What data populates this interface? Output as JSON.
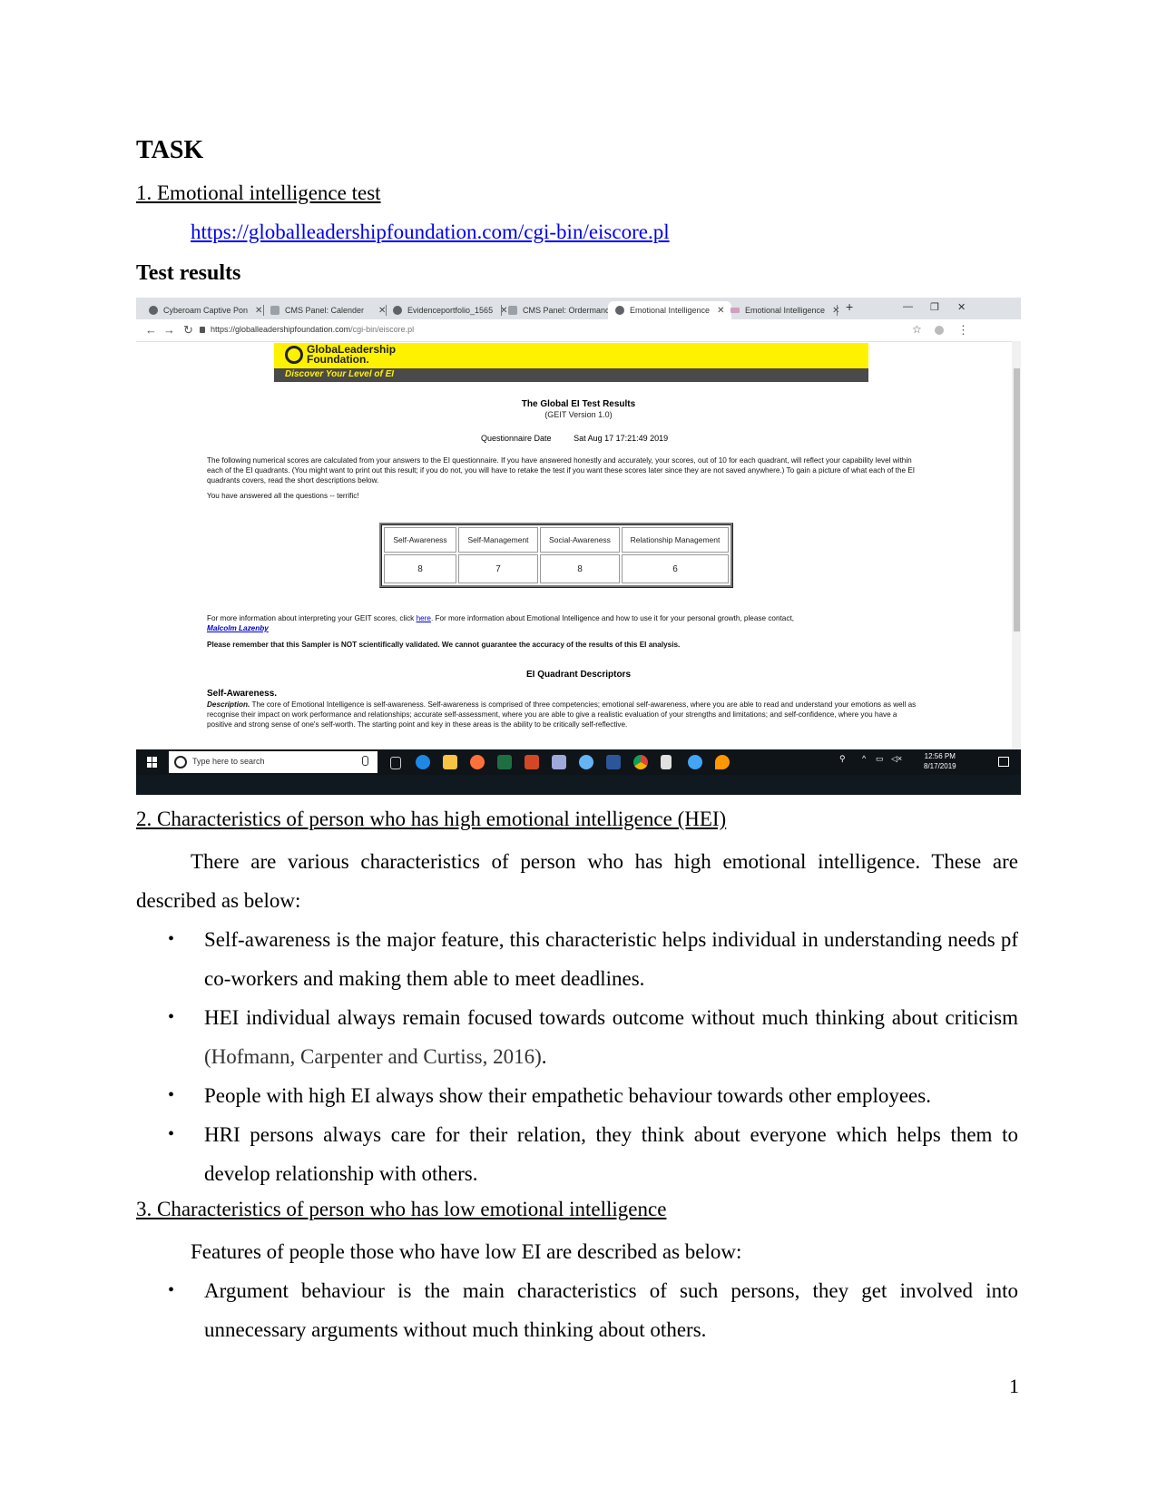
{
  "document": {
    "task_heading": "TASK",
    "section1_heading": "1. Emotional intelligence test",
    "test_link": "https://globalleadershipfoundation.com/cgi-bin/eiscore.pl",
    "test_results_heading": "Test results",
    "section2_heading": "2. Characteristics of person who has high emotional intelligence (HEI)",
    "section2_intro": "There are various characteristics of person who has high emotional intelligence. These are described as below:",
    "section2_bullets": [
      {
        "text": "Self-awareness is the major feature, this characteristic helps individual in understanding needs pf co-workers and making them able to meet deadlines.",
        "citation": ""
      },
      {
        "text": "HEI individual always remain focused towards outcome without much thinking about criticism ",
        "citation": "(Hofmann, Carpenter and Curtiss, 2016)",
        "after": "."
      },
      {
        "text": "People with high EI always show their empathetic behaviour towards other employees.",
        "citation": ""
      },
      {
        "text": "HRI persons always care for their relation, they think about everyone which helps them to develop relationship with others.",
        "citation": ""
      }
    ],
    "section3_heading": "3. Characteristics of person who has low emotional intelligence",
    "section3_intro": "Features of people those who have low EI are described as below:",
    "section3_bullets": [
      {
        "text": "Argument behaviour is the main characteristics of such persons, they get involved into unnecessary arguments without much thinking about others."
      }
    ],
    "bullet_glyph": "•",
    "page_number": "1"
  },
  "screenshot": {
    "tabs": [
      {
        "label": "Cyberoam Captive Pon",
        "icon": "globe-icon",
        "active": false
      },
      {
        "label": "CMS Panel: Calender",
        "icon": "cms-icon",
        "active": false
      },
      {
        "label": "Evidenceportfolio_1565",
        "icon": "globe-icon",
        "active": false
      },
      {
        "label": "CMS Panel: Ordermano",
        "icon": "cms-icon",
        "active": false
      },
      {
        "label": "Emotional Intelligence",
        "icon": "globe-icon",
        "active": true
      },
      {
        "label": "Emotional Intelligence",
        "icon": "mail-icon",
        "active": false
      }
    ],
    "close_glyph": "✕",
    "new_tab_glyph": "+",
    "window_controls": {
      "minimize": "—",
      "restore": "❐",
      "close": "✕"
    },
    "nav": {
      "back": "←",
      "forward": "→",
      "reload": "↻"
    },
    "url_host": "https://globalleadershipfoundation.com",
    "url_path": "/cgi-bin/eiscore.pl",
    "star_glyph": "☆",
    "menu_glyph": "⋮",
    "site": {
      "brand_line1": "GlobaLeadership",
      "brand_line2": "Foundation.",
      "tagline": "Discover Your Level of EI",
      "banner_color": "#fff200",
      "strip_color": "#4a4a4a"
    },
    "results": {
      "title": "The Global EI Test Results",
      "version": "(GEIT Version 1.0)",
      "date_label": "Questionnaire Date",
      "date_value": "Sat Aug 17 17:21:49 2019",
      "intro": "The following numerical scores are calculated from your answers to the EI questionnaire. If you have answered honestly and accurately, your scores, out of 10 for each quadrant, will reflect your capability level within each of the EI quadrants. (You might want to print out this result; if you do not, you will have to retake the test if you want these scores later since they are not saved anywhere.) To gain a picture of what each of the EI quadrants covers, read the short descriptions below.",
      "answered_all": "You have answered all the questions -- terrific!",
      "table": {
        "headers": [
          "Self-Awareness",
          "Self-Management",
          "Social-Awareness",
          "Relationship Management"
        ],
        "scores": [
          "8",
          "7",
          "8",
          "6"
        ]
      },
      "more_info_pre": "For more information about interpreting your GEIT scores, click ",
      "more_info_link": "here",
      "more_info_post": ". For more information about Emotional Intelligence and how to use it for your personal growth, please contact,",
      "contact_name": "Malcolm Lazenby",
      "disclaimer": "Please remember that this Sampler is NOT scientifically validated. We cannot guarantee the accuracy of the results of this EI analysis.",
      "descriptors_heading": "EI Quadrant Descriptors",
      "self_awareness_heading": "Self-Awareness.",
      "description_label": "Description.",
      "self_awareness_text": " The core of Emotional Intelligence is self-awareness. Self-awareness is comprised of three competencies; emotional self-awareness, where you are able to read and understand your emotions as well as recognise their impact on work performance and relationships; accurate self-assessment, where you are able to give a realistic evaluation of your strengths and limitations; and self-confidence, where you have a positive and strong sense of one's self-worth. The starting point and key in these areas is the ability to be critically self-reflective."
    },
    "taskbar": {
      "search_placeholder": "Type here to search",
      "apps": [
        "task-view",
        "edge",
        "file-explorer",
        "firefox",
        "excel",
        "powerpoint",
        "paint",
        "globe-app",
        "word",
        "chrome",
        "calculator",
        "outlook",
        "flame-app"
      ],
      "time": "12:56 PM",
      "date": "8/17/2019"
    }
  }
}
